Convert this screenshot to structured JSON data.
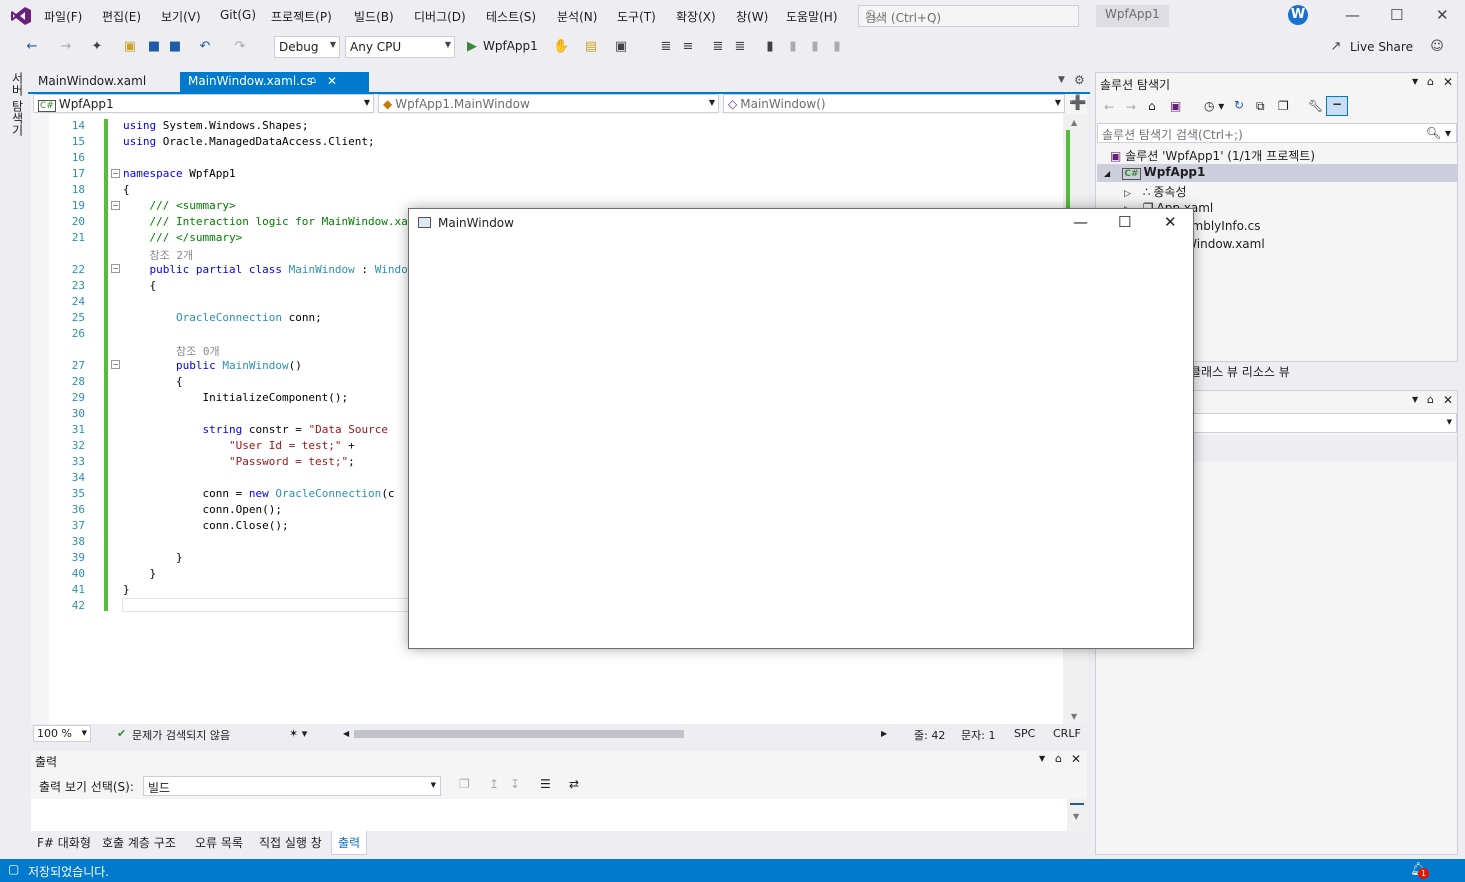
{
  "menu": {
    "items": [
      "파일(F)",
      "편집(E)",
      "보기(V)",
      "Git(G)",
      "프로젝트(P)",
      "빌드(B)",
      "디버그(D)",
      "테스트(S)",
      "분석(N)",
      "도구(T)",
      "확장(X)",
      "창(W)",
      "도움말(H)"
    ],
    "search_placeholder": "검색 (Ctrl+Q)",
    "solution_name": "WpfApp1",
    "account_initial": "W"
  },
  "toolbar": {
    "config": "Debug",
    "platform": "Any CPU",
    "run_target": "WpfApp1",
    "live_share": "Live Share"
  },
  "side": {
    "server_explorer": "서버 탐색기"
  },
  "tabs": {
    "xaml": "MainWindow.xaml",
    "cs": "MainWindow.xaml.cs"
  },
  "navbar": {
    "project": "WpfApp1",
    "class": "WpfApp1.MainWindow",
    "member": "MainWindow()"
  },
  "code": {
    "line_numbers": [
      "14",
      "15",
      "16",
      "17",
      "18",
      "19",
      "20",
      "21",
      "22",
      "23",
      "24",
      "25",
      "26",
      "27",
      "28",
      "29",
      "30",
      "31",
      "32",
      "33",
      "34",
      "35",
      "36",
      "37",
      "38",
      "39",
      "40",
      "41",
      "42"
    ],
    "ref_2": "참조 2개",
    "ref_0": "참조 0개"
  },
  "editor_status": {
    "zoom": "100 %",
    "issues": "문제가 검색되지 않음",
    "line": "줄: 42",
    "col": "문자: 1",
    "indent": "SPC",
    "eol": "CRLF"
  },
  "output": {
    "title": "출력",
    "source_label": "출력 보기 선택(S):",
    "source_value": "빌드"
  },
  "bottom_tabs": [
    "F# 대화형",
    "호출 계층 구조",
    "오류 목록",
    "직접 실행 창",
    "출력"
  ],
  "solution_explorer": {
    "title": "솔루션 탐색기",
    "search_placeholder": "솔루션 탐색기 검색(Ctrl+;)",
    "solution_node": "솔루션 'WpfApp1' (1/1개 프로젝트)",
    "project_node": "WpfApp1",
    "dependencies": "종속성",
    "app_xaml": "App.xaml",
    "assembly_info": "AssemblyInfo.cs",
    "mainwindow_xaml": "MainWindow.xaml"
  },
  "class_view_tabs": "클래스 뷰   리소스 뷰",
  "app_window": {
    "title": "MainWindow"
  },
  "statusbar": {
    "text": "저장되었습니다.",
    "notifications": "1"
  },
  "colors": {
    "accent": "#007ACC",
    "change_bar": "#57BB3F",
    "chrome": "#EEEEF2"
  }
}
